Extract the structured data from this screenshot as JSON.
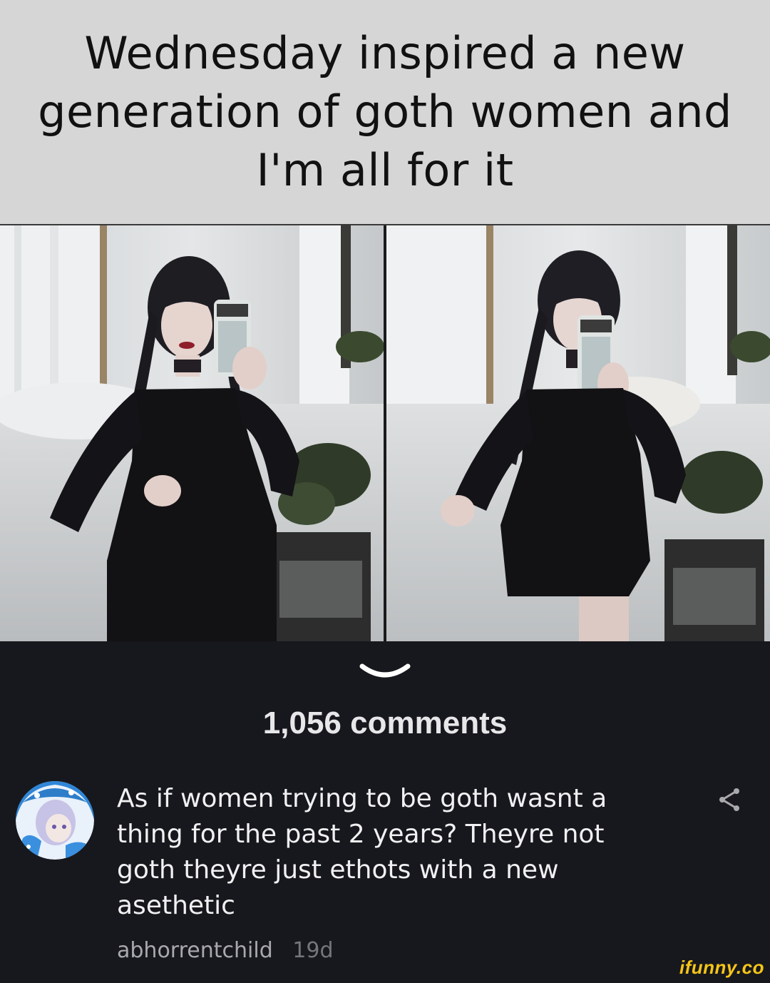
{
  "caption": {
    "text": "Wednesday inspired a new generation of goth women and I'm all for it"
  },
  "photos": [
    {
      "icon": "photo-left"
    },
    {
      "icon": "photo-right"
    }
  ],
  "collapse": {
    "icon": "chevron-down-icon"
  },
  "comments": {
    "count_label": "1,056 comments"
  },
  "comment": {
    "text": "As if women trying to be goth wasnt a thing for the past 2 years? Theyre not goth theyre just ethots with a new asethetic",
    "author": "abhorrentchild",
    "age": "19d",
    "share_icon": "share-icon"
  },
  "watermark": {
    "text": "ifunny.co"
  },
  "colors": {
    "background": "#17181d",
    "caption_bg": "#d6d6d6",
    "watermark": "#f5c518"
  }
}
